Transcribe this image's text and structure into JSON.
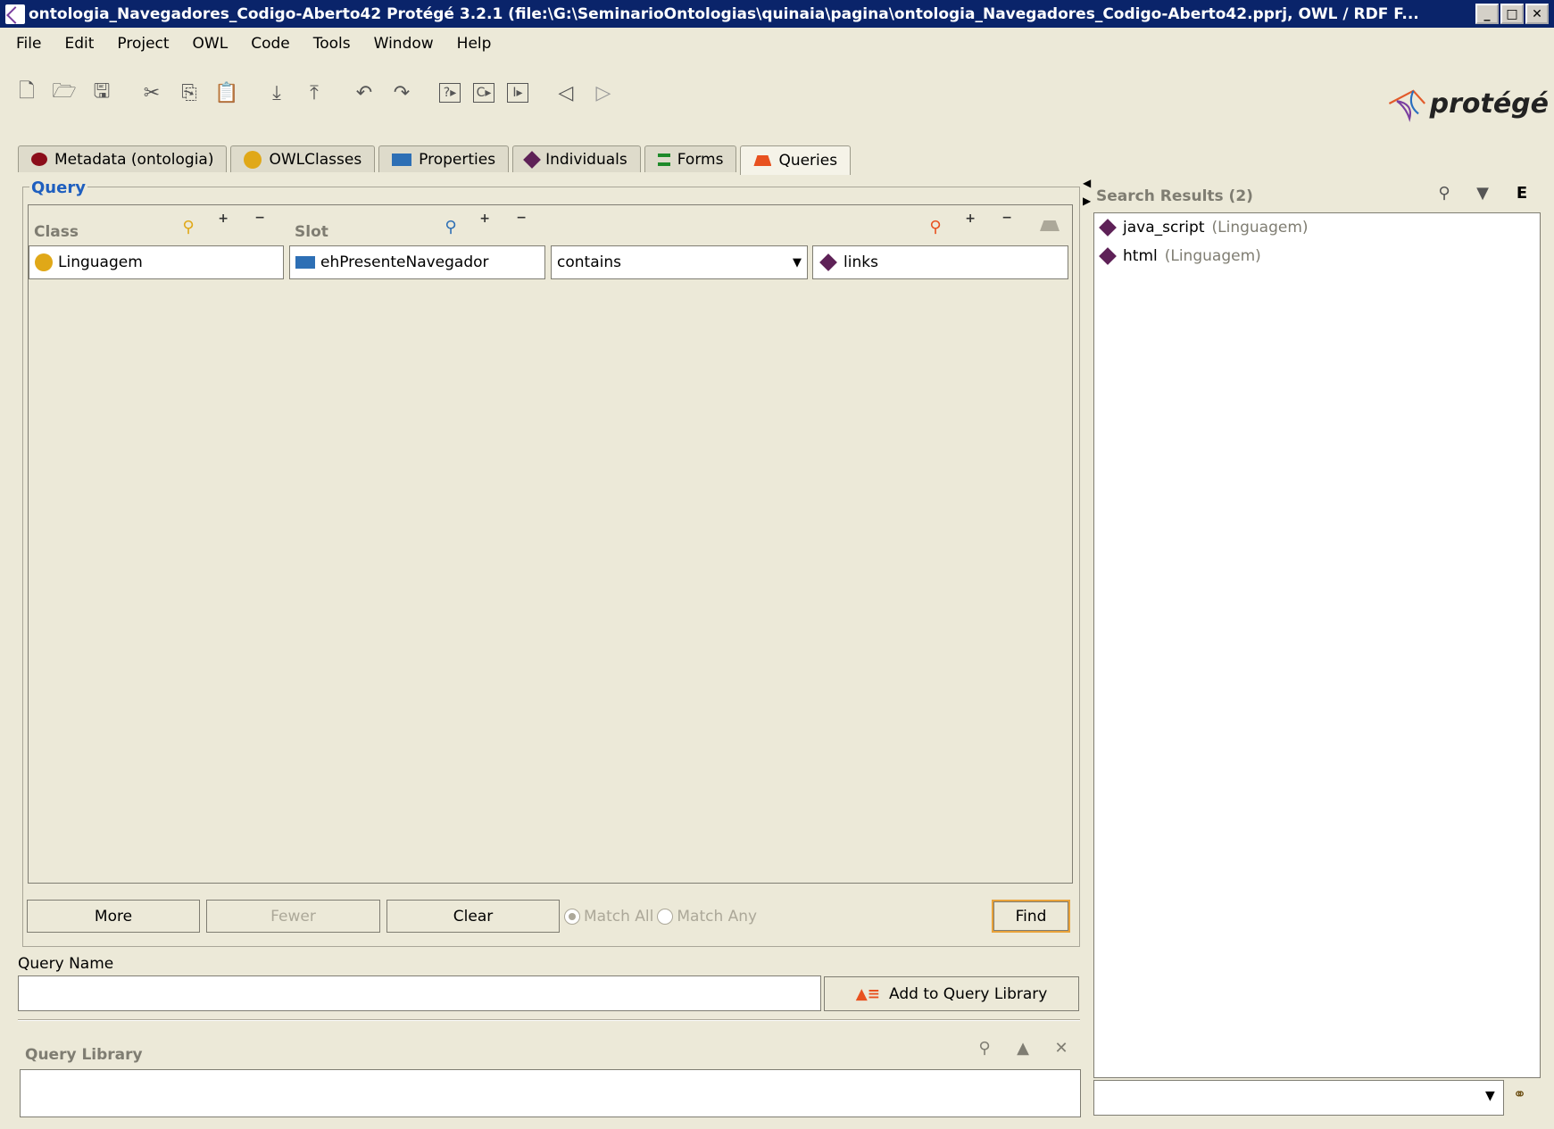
{
  "window": {
    "title": "ontologia_Navegadores_Codigo-Aberto42  Protégé 3.2.1    (file:\\G:\\SeminarioOntologias\\quinaia\\pagina\\ontologia_Navegadores_Codigo-Aberto42.pprj, OWL / RDF F..."
  },
  "menu": [
    "File",
    "Edit",
    "Project",
    "OWL",
    "Code",
    "Tools",
    "Window",
    "Help"
  ],
  "logo": {
    "text": "protégé"
  },
  "tabs": [
    {
      "label": "Metadata (ontologia)",
      "icon": "metadata-icon"
    },
    {
      "label": "OWLClasses",
      "icon": "owl-classes-icon"
    },
    {
      "label": "Properties",
      "icon": "properties-icon"
    },
    {
      "label": "Individuals",
      "icon": "individuals-icon"
    },
    {
      "label": "Forms",
      "icon": "forms-icon"
    },
    {
      "label": "Queries",
      "icon": "queries-icon",
      "active": true
    }
  ],
  "query": {
    "title": "Query",
    "class_label": "Class",
    "slot_label": "Slot",
    "class_value": "Linguagem",
    "slot_value": "ehPresenteNavegador",
    "operator": "contains",
    "value": "links",
    "buttons": {
      "more": "More",
      "fewer": "Fewer",
      "clear": "Clear",
      "find": "Find"
    },
    "match_all": "Match All",
    "match_any": "Match Any",
    "match_selected": "all"
  },
  "query_name": {
    "label": "Query Name",
    "value": "",
    "add_button": "Add to Query Library"
  },
  "query_library": {
    "label": "Query Library"
  },
  "search_results": {
    "header": "Search Results (2)",
    "items": [
      {
        "name": "java_script",
        "type": "(Linguagem)"
      },
      {
        "name": "html",
        "type": "(Linguagem)"
      }
    ]
  },
  "colors": {
    "title_bar": "#0a246a",
    "panel_bg": "#ece9d8",
    "query_label": "#1f5fbf",
    "find_border": "#e8a23a"
  }
}
